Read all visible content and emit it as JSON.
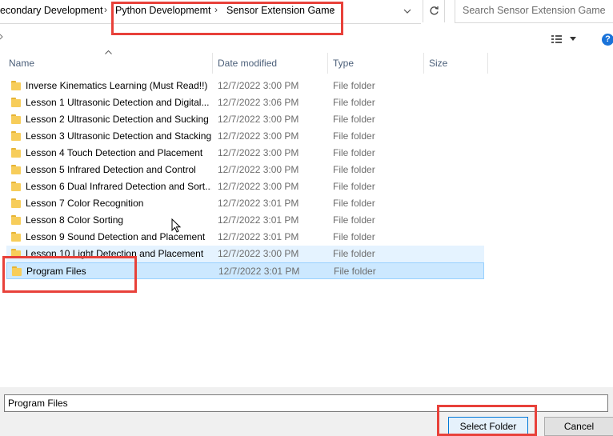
{
  "address_bar": {
    "crumbs": [
      "econdary Development",
      "Python Developmemt",
      "Sensor Extension Game"
    ],
    "separator": "›"
  },
  "search": {
    "placeholder": "Search Sensor Extension Game"
  },
  "columns": {
    "name": "Name",
    "date": "Date modified",
    "type": "Type",
    "size": "Size"
  },
  "files": [
    {
      "name": "Inverse Kinematics Learning (Must Read!!)",
      "date": "12/7/2022 3:00 PM",
      "type": "File folder"
    },
    {
      "name": "Lesson 1 Ultrasonic Detection and Digital...",
      "date": "12/7/2022 3:06 PM",
      "type": "File folder"
    },
    {
      "name": "Lesson 2 Ultrasonic Detection and Sucking",
      "date": "12/7/2022 3:00 PM",
      "type": "File folder"
    },
    {
      "name": "Lesson 3 Ultrasonic Detection and Stacking",
      "date": "12/7/2022 3:00 PM",
      "type": "File folder"
    },
    {
      "name": "Lesson 4 Touch Detection and Placement",
      "date": "12/7/2022 3:00 PM",
      "type": "File folder"
    },
    {
      "name": "Lesson 5 Infrared Detection and Control",
      "date": "12/7/2022 3:00 PM",
      "type": "File folder"
    },
    {
      "name": "Lesson 6 Dual Infrared Detection and Sort...",
      "date": "12/7/2022 3:00 PM",
      "type": "File folder"
    },
    {
      "name": "Lesson 7 Color Recognition",
      "date": "12/7/2022 3:01 PM",
      "type": "File folder"
    },
    {
      "name": "Lesson 8 Color Sorting",
      "date": "12/7/2022 3:01 PM",
      "type": "File folder"
    },
    {
      "name": "Lesson 9 Sound Detection and Placement",
      "date": "12/7/2022 3:01 PM",
      "type": "File folder"
    },
    {
      "name": "Lesson 10 Light Detection and Placement",
      "date": "12/7/2022 3:00 PM",
      "type": "File folder"
    },
    {
      "name": "Program Files",
      "date": "12/7/2022 3:01 PM",
      "type": "File folder"
    }
  ],
  "folder_field": {
    "value": "Program Files"
  },
  "buttons": {
    "select": "Select Folder",
    "cancel": "Cancel"
  },
  "colors": {
    "highlight": "#e8413a",
    "selected_row": "#cce8ff",
    "hover_row": "#e5f3ff",
    "accent": "#0078d7"
  }
}
